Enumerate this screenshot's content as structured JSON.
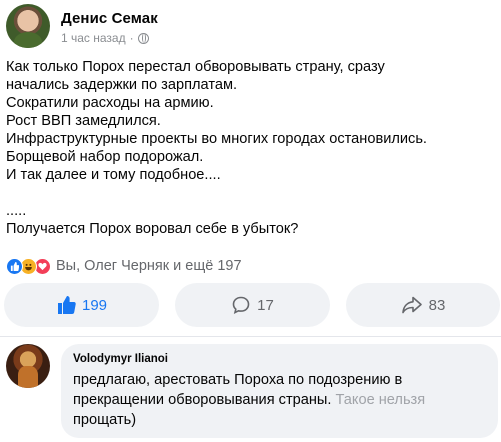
{
  "post": {
    "author": "Денис Семак",
    "time": "1 час назад",
    "meta_sep": "·",
    "privacy_icon": "globe-icon",
    "lines": [
      "Как только Порох перестал обворовывать страну, сразу",
      "начались задержки по зарплатам.",
      "Сократили расходы на армию.",
      "Рост ВВП замедлился.",
      "Инфраструктурные проекты во многих городах остановились.",
      "Борщевой набор подорожал.",
      "И так далее и тому подобное....",
      "",
      ".....",
      "Получается Порох воровал себе в убыток?"
    ]
  },
  "reactions": {
    "icons": [
      "like-icon",
      "haha-icon",
      "love-icon"
    ],
    "summary": "Вы, Олег Черняк и ещё 197"
  },
  "actions": {
    "like_count": "199",
    "comment_count": "17",
    "share_count": "83"
  },
  "comment": {
    "author": "Volodymyr Ilianoi",
    "text_main": "предлагаю, арестовать Пороха по подозрению в прекращении обворовывания страны. ",
    "text_faded": "Такое нельзя",
    "text_end": " прощать)"
  },
  "colors": {
    "accent": "#1877f2",
    "muted": "#65676b",
    "bubble": "#f0f2f5"
  }
}
